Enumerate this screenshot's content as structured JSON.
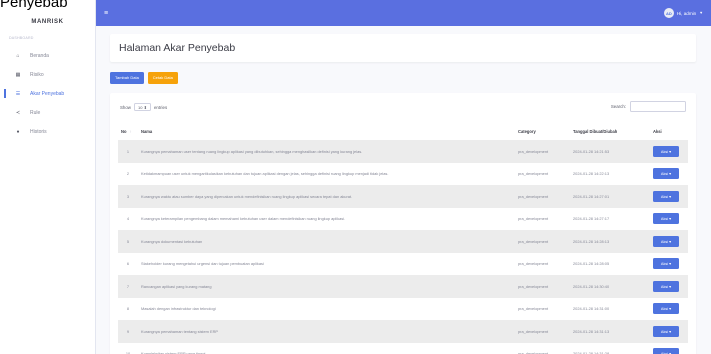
{
  "page_title_fragment": "Penyebab",
  "sidebar": {
    "brand": "MANRISK",
    "section_label": "DASHBOARD",
    "items": [
      {
        "label": "Beranda",
        "icon": "home-icon",
        "glyph": "⌂"
      },
      {
        "label": "Risiko",
        "icon": "grid-icon",
        "glyph": "▦"
      },
      {
        "label": "Akar Penyebab",
        "icon": "list-icon",
        "glyph": "☰",
        "active": true
      },
      {
        "label": "Rule",
        "icon": "share-icon",
        "glyph": "≺"
      },
      {
        "label": "Historis",
        "icon": "user-icon",
        "glyph": "●"
      }
    ]
  },
  "topbar": {
    "menu_glyph": "≡",
    "avatar_text": "AD",
    "user_label": "Hi, admin",
    "caret": "▼"
  },
  "header": {
    "title": "Halaman Akar Penyebab"
  },
  "actions": {
    "add_label": "Tambah Data",
    "print_label": "Cetak Data"
  },
  "table_controls": {
    "show_label": "Show",
    "entries_value": "10 ⬍",
    "entries_label": "entries",
    "search_label": "Search:"
  },
  "table": {
    "columns": [
      "No",
      "Nama",
      "Category",
      "Tanggal Dibuat/Diubah",
      "Aksi"
    ],
    "sort_glyph": "↑",
    "action_label": "Aksi ▾",
    "rows": [
      {
        "no": "1",
        "nama": "Kurangnya pemahaman user tentang ruang lingkup aplikasi yang dibutuhkan, sehingga menghasilkan definisi yang kurang jelas.",
        "category": "pra_development",
        "date": "2024-01-28 14:21:53"
      },
      {
        "no": "2",
        "nama": "Ketidakmampuan user untuk mengartikulasikan kebutuhan dan tujuan aplikasi dengan jelas, sehingga definisi ruang lingkup menjadi tidak jelas.",
        "category": "pra_development",
        "date": "2024-01-28 14:22:13"
      },
      {
        "no": "3",
        "nama": "Kurangnya waktu atau sumber daya yang dipercakan untuk mendefinisikan ruang lingkup aplikasi secara tepat dan akurat.",
        "category": "pra_development",
        "date": "2024-01-28 14:27:01"
      },
      {
        "no": "4",
        "nama": "Kurangnya keterampilan pengembang dalam memahami kebutuhan user dalam mendefinisikan ruang lingkup aplikasi.",
        "category": "pra_development",
        "date": "2024-01-28 14:27:17"
      },
      {
        "no": "5",
        "nama": "Kurangnya dokumentasi kebutuhan",
        "category": "pra_development",
        "date": "2024-01-28 14:28:13"
      },
      {
        "no": "6",
        "nama": "Stakeholder kurang mengetahui urgensi dan tujuan pembuatan aplikasi",
        "category": "pra_development",
        "date": "2024-01-28 14:28:05"
      },
      {
        "no": "7",
        "nama": "Rancangan aplikasi yang kurang matang",
        "category": "pra_development",
        "date": "2024-01-28 14:30:40"
      },
      {
        "no": "8",
        "nama": "Masalah dengan infrastruktur dan teknologi",
        "category": "pra_development",
        "date": "2024-01-28 14:31:00"
      },
      {
        "no": "9",
        "nama": "Kurangnya pemahaman tentang sistem ERP",
        "category": "pra_development",
        "date": "2024-01-28 14:31:13"
      },
      {
        "no": "10",
        "nama": "Kompleksitas sistem ERP yang tinggi",
        "category": "pra_development",
        "date": "2024-01-28 14:31:28"
      }
    ]
  },
  "colors": {
    "primary": "#4e73df",
    "topbar": "#5a6fe0",
    "warning": "#f6a20a"
  }
}
